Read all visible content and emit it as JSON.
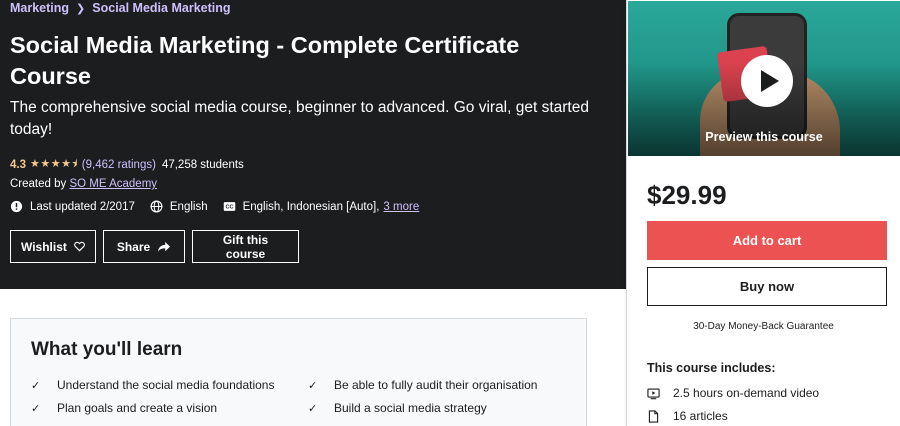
{
  "breadcrumb": {
    "items": [
      "Marketing",
      "Social Media Marketing"
    ]
  },
  "course": {
    "title": "Social Media Marketing - Complete Certificate Course",
    "subtitle": "The comprehensive social media course, beginner to advanced. Go viral, get started today!",
    "rating": "4.3",
    "stars_icon": "star-rating-icon",
    "ratings_count": "(9,462 ratings)",
    "students": "47,258 students",
    "created_by_label": "Created by",
    "author": "SO ME Academy",
    "last_updated": "Last updated 2/2017",
    "language": "English",
    "captions": "English, Indonesian [Auto],",
    "captions_more": "3 more"
  },
  "actions": {
    "wishlist": "Wishlist",
    "share": "Share",
    "gift": "Gift this course"
  },
  "learn": {
    "title": "What you'll learn",
    "items": [
      "Understand the social media foundations",
      "Be able to fully audit their organisation",
      "Plan goals and create a vision",
      "Build a social media strategy"
    ]
  },
  "sidebar": {
    "preview_label": "Preview this course",
    "price": "$29.99",
    "add_to_cart": "Add to cart",
    "buy_now": "Buy now",
    "guarantee": "30-Day Money-Back Guarantee",
    "includes_title": "This course includes:",
    "includes": [
      "2.5 hours on-demand video",
      "16 articles"
    ]
  },
  "colors": {
    "hero_bg": "#1c1d1f",
    "link_purple": "#cec0fc",
    "star": "#f3ca8c",
    "cart": "#ec5252"
  }
}
